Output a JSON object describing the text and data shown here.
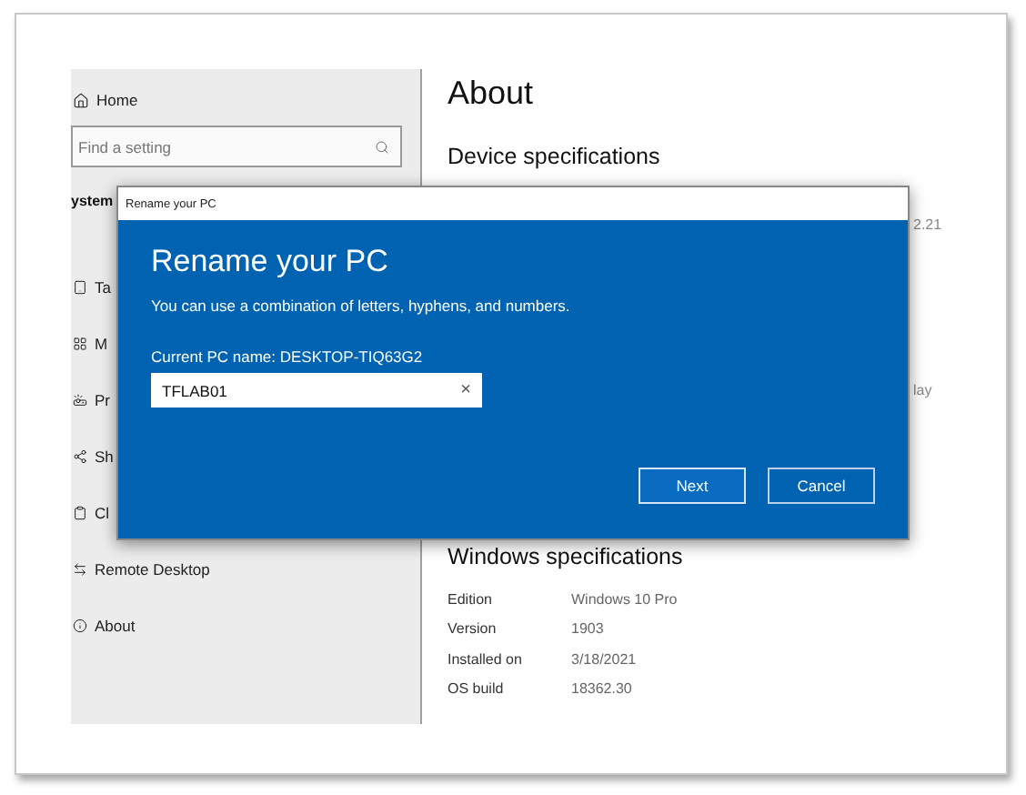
{
  "settings": {
    "sidebar": {
      "home": "Home",
      "search": {
        "placeholder": "Find a setting"
      },
      "section": "ystem",
      "items": [
        {
          "kind": "tablet",
          "label": "Ta"
        },
        {
          "kind": "multitask",
          "label": "M"
        },
        {
          "kind": "project",
          "label": "Pr"
        },
        {
          "kind": "share",
          "label": "Sh"
        },
        {
          "kind": "clipboard",
          "label": "Cl"
        },
        {
          "kind": "remote",
          "label": "Remote Desktop"
        },
        {
          "kind": "about",
          "label": "About"
        }
      ]
    },
    "content": {
      "title": "About",
      "device_heading": "Device specifications",
      "device_fragments": [
        "2.21",
        "lay"
      ],
      "windows_heading": "Windows specifications",
      "windows_rows": [
        {
          "label": "Edition",
          "value": "Windows 10 Pro"
        },
        {
          "label": "Version",
          "value": "1903"
        },
        {
          "label": "Installed on",
          "value": "3/18/2021"
        },
        {
          "label": "OS build",
          "value": "18362.30"
        }
      ]
    }
  },
  "dialog": {
    "window_title": "Rename your PC",
    "heading": "Rename your PC",
    "description": "You can use a combination of letters, hyphens, and numbers.",
    "current_name": "Current PC name: DESKTOP-TIQ63G2",
    "input": {
      "value": "TFLAB01"
    },
    "clear": "×",
    "buttons": [
      {
        "label": "Next",
        "kind": "primary"
      },
      {
        "label": "Cancel",
        "kind": "secondary"
      }
    ]
  }
}
